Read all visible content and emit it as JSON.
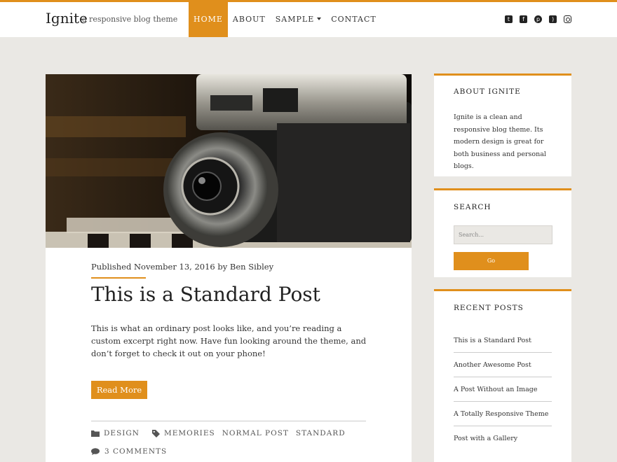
{
  "colors": {
    "accent": "#e08f1c",
    "background": "#eae8e4"
  },
  "header": {
    "site_title": "Ignite",
    "tagline": "a responsive blog theme",
    "nav": [
      {
        "label": "HOME",
        "active": true
      },
      {
        "label": "ABOUT"
      },
      {
        "label": "SAMPLE",
        "dropdown": true
      },
      {
        "label": "CONTACT"
      }
    ],
    "social_icons": [
      "twitter-icon",
      "facebook-icon",
      "pinterest-icon",
      "rss-icon",
      "instagram-icon"
    ]
  },
  "post": {
    "featured_image": "vintage camera on piano keys",
    "meta": "Published November 13, 2016 by Ben Sibley",
    "title": "This is a Standard Post",
    "excerpt": "This is what an ordinary post looks like, and you’re reading a custom excerpt right now. Have fun looking around the theme, and don’t forget to check it out on your phone!",
    "read_more": "Read More",
    "category": "DESIGN",
    "tags": [
      "MEMORIES",
      "NORMAL POST",
      "STANDARD"
    ],
    "comments": "3 COMMENTS"
  },
  "sidebar": {
    "about": {
      "title": "ABOUT IGNITE",
      "text": "Ignite is a clean and responsive blog theme. Its modern design is great for both business and personal blogs."
    },
    "search": {
      "title": "SEARCH",
      "placeholder": "Search...",
      "button": "Go"
    },
    "recent": {
      "title": "RECENT POSTS",
      "items": [
        "This is a Standard Post",
        "Another Awesome Post",
        "A Post Without an Image",
        "A Totally Responsive Theme",
        "Post with a Gallery"
      ]
    }
  }
}
